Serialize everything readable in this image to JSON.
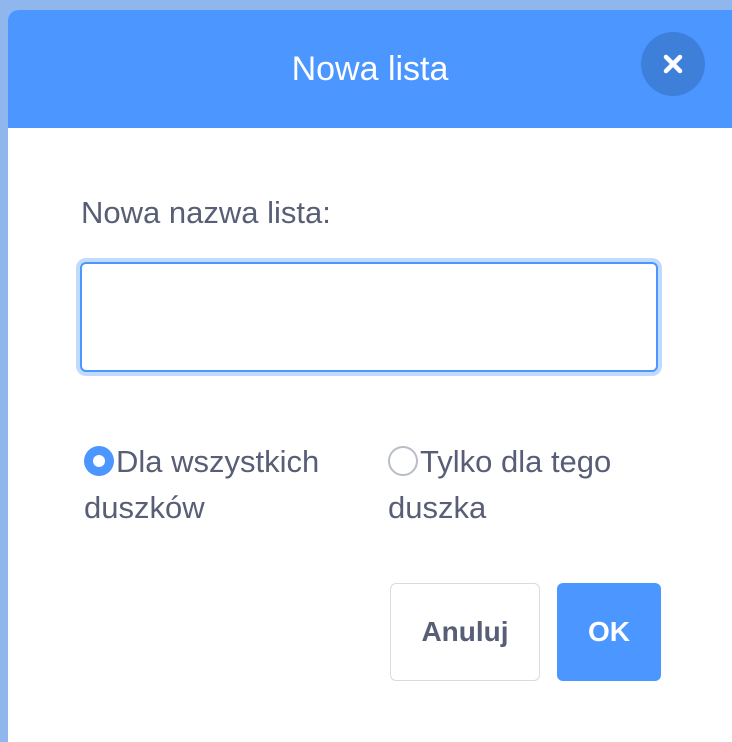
{
  "dialog": {
    "title": "Nowa lista",
    "close_icon": "close-icon",
    "name_label": "Nowa nazwa lista:",
    "name_value": "",
    "scope_options": [
      {
        "label": "Dla wszystkich duszków",
        "selected": true
      },
      {
        "label": "Tylko dla tego duszka",
        "selected": false
      }
    ],
    "cancel_label": "Anuluj",
    "ok_label": "OK"
  },
  "colors": {
    "accent": "#4c97ff",
    "close_button": "#3d7fd9",
    "text": "#575e75",
    "backdrop": "#8fb7ee"
  }
}
